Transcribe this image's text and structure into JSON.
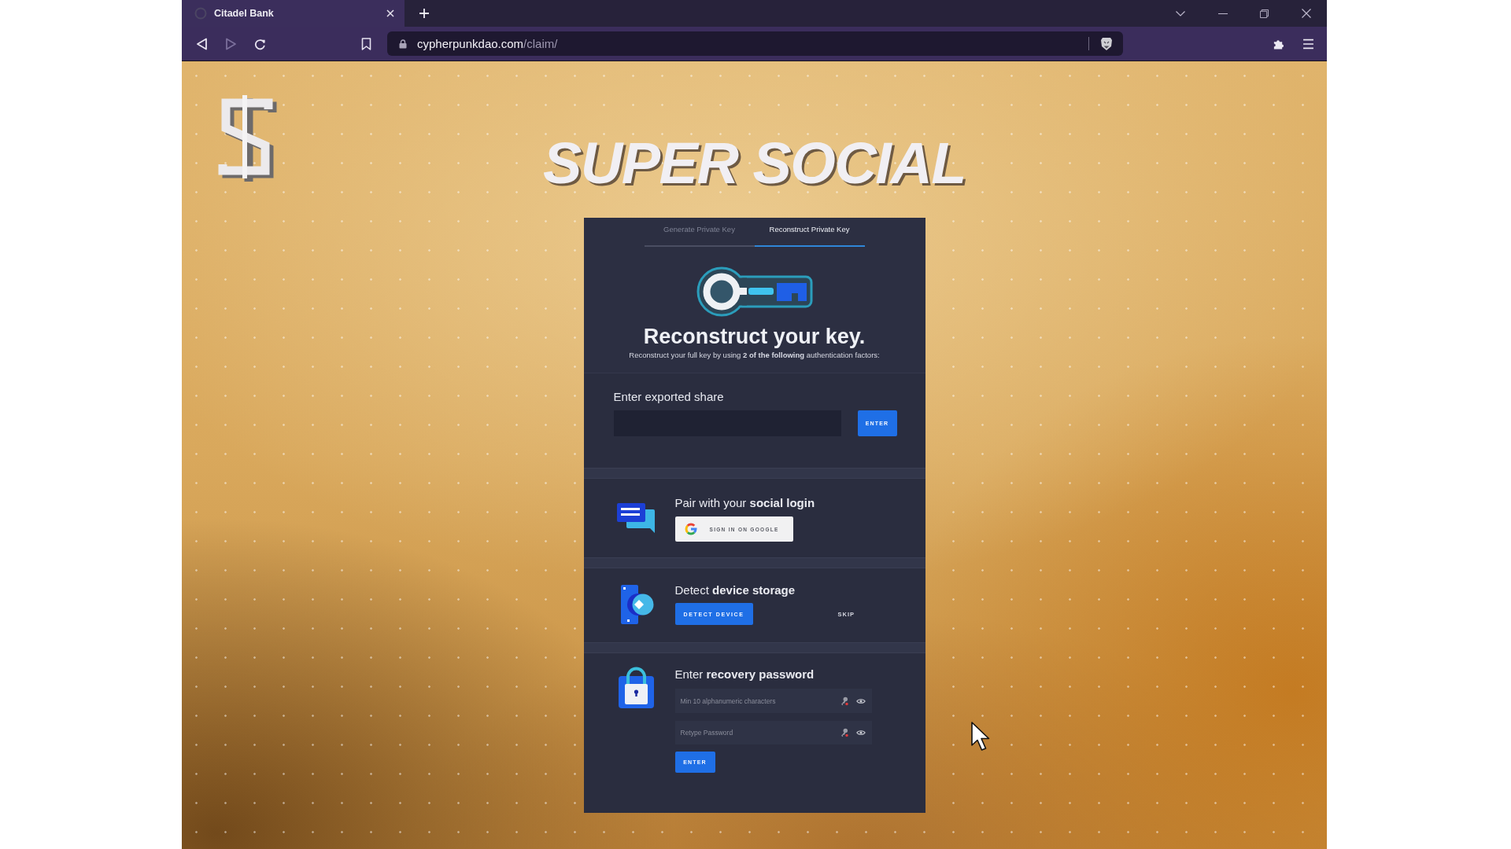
{
  "browser": {
    "tabs": [
      {
        "title": "Citadel Bank",
        "selected": true
      }
    ],
    "nav_buttons": [
      {
        "kind": "back",
        "disabled": false
      },
      {
        "kind": "forward",
        "disabled": true
      },
      {
        "kind": "reload",
        "disabled": false
      }
    ],
    "address": {
      "domain": "cypherpunkdao.com",
      "path": "/claim/"
    }
  },
  "page": {
    "title": "SUPER SOCIAL",
    "card": {
      "tabs": [
        {
          "label": "Generate Private Key",
          "selected": false
        },
        {
          "label": "Reconstruct Private Key",
          "selected": true
        }
      ],
      "heading": "Reconstruct your key.",
      "subtitle": "Reconstruct your full key by using **2 of the following** authentication factors:",
      "sections": [
        {
          "kind": "share",
          "label": "Enter exported share",
          "button": "ENTER"
        },
        {
          "kind": "social",
          "title": "Pair with your **social login**",
          "button": "SIGN IN ON GOOGLE"
        },
        {
          "kind": "device",
          "title": "Detect **device storage**",
          "button": "DETECT DEVICE",
          "link": "SKIP"
        },
        {
          "kind": "password",
          "title": "Enter **recovery password**",
          "fields": [
            {
              "placeholder": "Min 10 alphanumeric characters"
            },
            {
              "placeholder": "Retype Password"
            }
          ],
          "button": "ENTER"
        }
      ]
    }
  }
}
